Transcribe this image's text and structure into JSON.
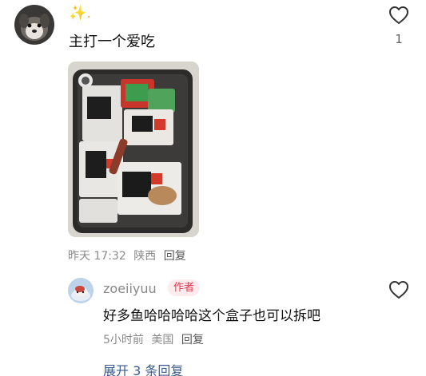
{
  "main_comment": {
    "author": "✨.",
    "text": "主打一个爱吃",
    "like_count": "1",
    "like_icon": "heart-outline-icon",
    "time": "昨天 17:32",
    "location": "陕西",
    "reply_label": "回复"
  },
  "reply": {
    "author": "zoeiiyuu",
    "author_tag": "作者",
    "text": "好多鱼哈哈哈哈这个盒子也可以拆吧",
    "like_icon": "heart-outline-icon",
    "time": "5小时前",
    "location": "美国",
    "reply_label": "回复"
  },
  "expand_replies": {
    "label": "展开 3 条回复",
    "icon": "chevron-down-icon"
  },
  "colors": {
    "author_tag_bg": "#fdebee",
    "author_tag_text": "#e6354e",
    "expand_link": "#3a5a8c",
    "meta_text": "#8a8a8a"
  }
}
